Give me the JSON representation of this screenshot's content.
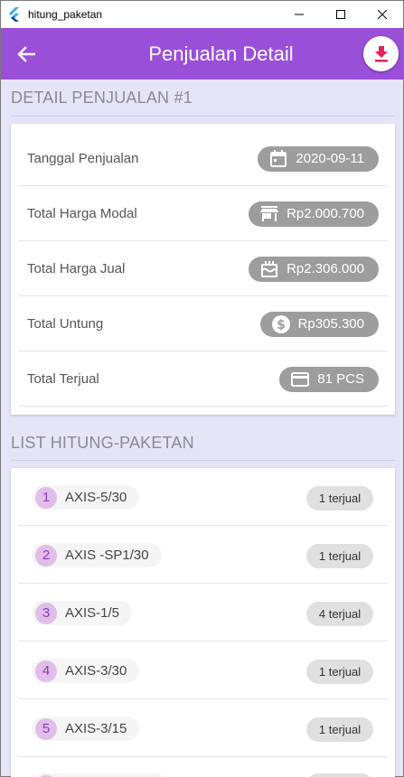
{
  "window": {
    "title": "hitung_paketan"
  },
  "appbar": {
    "title": "Penjualan Detail",
    "back_icon": "arrow-left-icon",
    "action_icon": "download-icon"
  },
  "detail": {
    "header": "DETAIL PENJUALAN #1",
    "rows": [
      {
        "label": "Tanggal Penjualan",
        "value": "2020-09-11",
        "icon": "calendar-icon"
      },
      {
        "label": "Total Harga Modal",
        "value": "Rp2.000.700",
        "icon": "store-icon"
      },
      {
        "label": "Total Harga Jual",
        "value": "Rp2.306.000",
        "icon": "cake-icon"
      },
      {
        "label": "Total Untung",
        "value": "Rp305.300",
        "icon": "dollar-icon"
      },
      {
        "label": "Total Terjual",
        "value": "81 PCS",
        "icon": "credit-card-icon"
      }
    ]
  },
  "list": {
    "header": "LIST HITUNG-PAKETAN",
    "items": [
      {
        "num": "1",
        "name": "AXIS-5/30",
        "sold": "1 terjual"
      },
      {
        "num": "2",
        "name": "AXIS -SP1/30",
        "sold": "1 terjual"
      },
      {
        "num": "3",
        "name": "AXIS-1/5",
        "sold": "4 terjual"
      },
      {
        "num": "4",
        "name": "AXIS-3/30",
        "sold": "1 terjual"
      },
      {
        "num": "5",
        "name": "AXIS-3/15",
        "sold": "1 terjual"
      }
    ]
  },
  "colors": {
    "appbar": "#9a4fd9",
    "background": "#e6e5f8",
    "chip": "#9d9d9d",
    "badge": "#e1bde9",
    "download": "#e0245e"
  }
}
